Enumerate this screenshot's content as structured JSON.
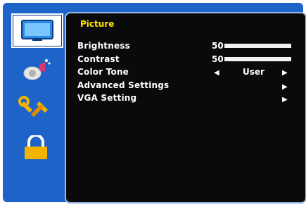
{
  "sidebar": {
    "tabs": [
      {
        "name": "picture",
        "icon": "monitor-icon",
        "selected": true
      },
      {
        "name": "sound",
        "icon": "speaker-icon",
        "selected": false
      },
      {
        "name": "setup",
        "icon": "tools-icon",
        "selected": false
      },
      {
        "name": "lock",
        "icon": "padlock-icon",
        "selected": false
      }
    ]
  },
  "menu": {
    "title": "Picture",
    "items": [
      {
        "label": "Brightness",
        "value": "50",
        "level": 0.5
      },
      {
        "label": "Contrast",
        "value": "50",
        "level": 0.5
      },
      {
        "label": "Color Tone",
        "left_arrow": "◀",
        "value": "User",
        "right_arrow": "▶"
      },
      {
        "label": "Advanced Settings",
        "right_arrow": "▶"
      },
      {
        "label": "VGA Setting",
        "right_arrow": "▶"
      }
    ]
  },
  "colors": {
    "frame": "#1e64c8",
    "panel": "#0a0a0a",
    "title": "#ffe400",
    "text": "#ffffff"
  }
}
